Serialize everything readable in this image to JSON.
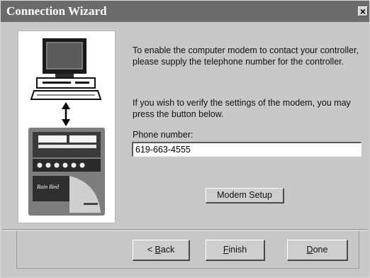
{
  "window": {
    "title": "Connection Wizard",
    "close_symbol": "×"
  },
  "illustration": {
    "icon": "computer-to-controller-illustration",
    "controller_brand": "Rain Bird"
  },
  "instructions": {
    "paragraph1": "To enable the computer modem to contact your controller, please supply the telephone number for the controller.",
    "paragraph2": "If you wish to verify the settings of the modem, you may press the button below."
  },
  "phone": {
    "label": "Phone number:",
    "value": "619-663-4555"
  },
  "buttons": {
    "modem_setup": "Modem Setup",
    "back_prefix": "< ",
    "back_mnemonic": "B",
    "back_rest": "ack",
    "finish_mnemonic": "F",
    "finish_rest": "inish",
    "done_mnemonic": "D",
    "done_rest": "one"
  }
}
